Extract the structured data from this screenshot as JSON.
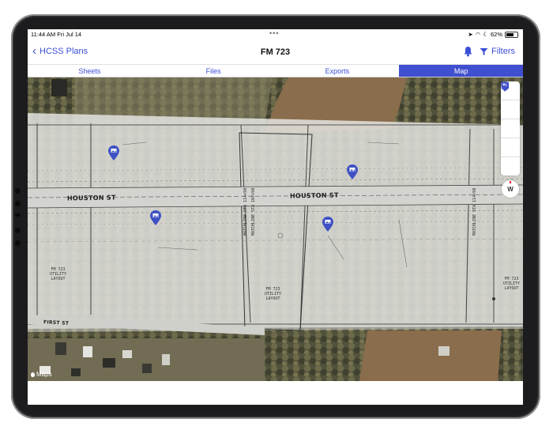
{
  "status_bar": {
    "time": "11:44 AM",
    "date": "Fri Jul 14",
    "battery": "62%"
  },
  "nav": {
    "back_label": "HCSS Plans",
    "title": "FM 723",
    "filters_label": "Filters"
  },
  "tabs": [
    {
      "label": "Sheets",
      "active": false
    },
    {
      "label": "Files",
      "active": false
    },
    {
      "label": "Exports",
      "active": false
    },
    {
      "label": "Map",
      "active": true
    }
  ],
  "map": {
    "street_labels": [
      "HOUSTON ST",
      "HOUSTON ST",
      "FIRST ST"
    ],
    "matchline_labels": [
      "MATCHLINE STA 114+50",
      "MATCHLINE STA 107+50",
      "MATCHLINE STA 114+50"
    ],
    "sheet_labels": [
      "FM 723\nUTILITY\nLAYOUT",
      "FM 723\nUTILITY\nLAYOUT",
      "FM 723\nUTILITY\nLAYOUT"
    ],
    "attribution": "Maps",
    "compass_label": "W",
    "controls": [
      "map-layers-icon",
      "square-icon",
      "plans-icon",
      "photo-pin-icon",
      "person-location-icon"
    ]
  },
  "colors": {
    "accent": "#3a4fd6",
    "tab_active": "#3f4fcf",
    "pin": "#3f51c4"
  }
}
